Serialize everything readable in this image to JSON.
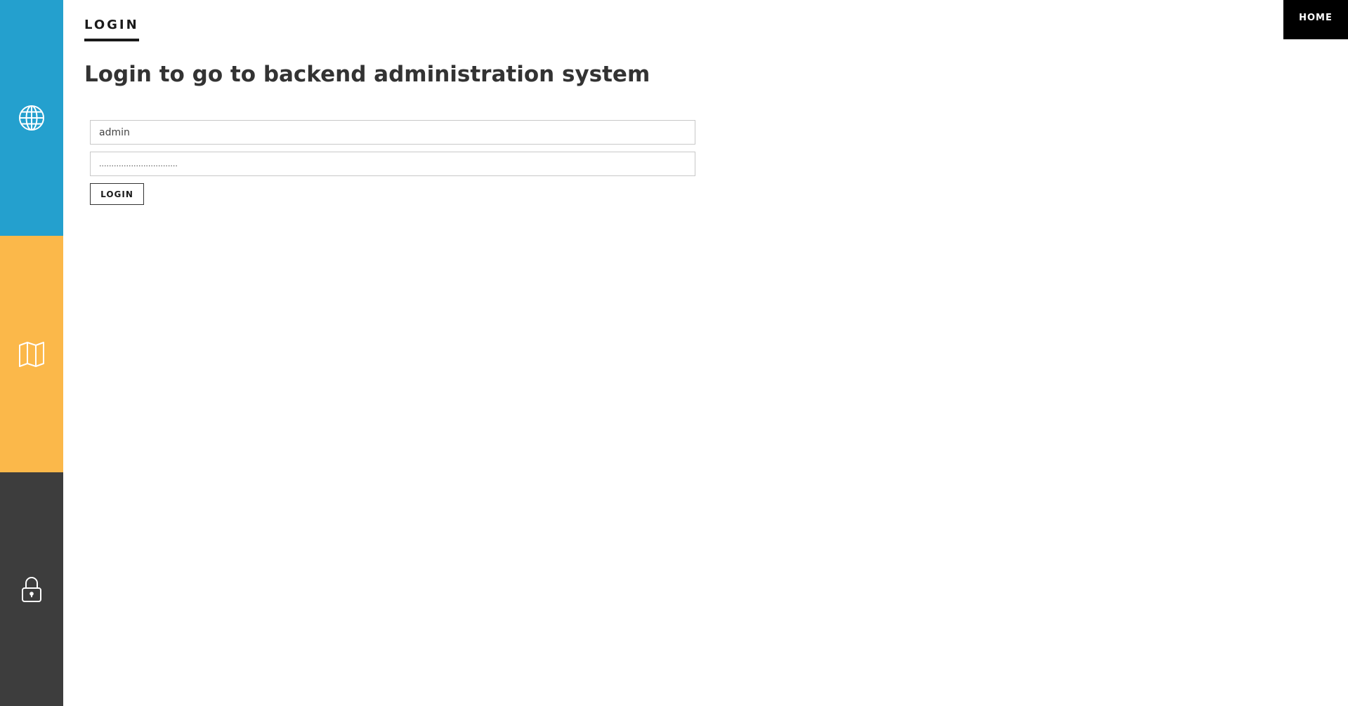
{
  "colors": {
    "sidebar_blue": "#24a0ce",
    "sidebar_orange": "#fbb84a",
    "sidebar_dark": "#3d3d3d",
    "home_bg": "#000000"
  },
  "sidebar": {
    "items": [
      {
        "icon": "globe-icon"
      },
      {
        "icon": "map-icon"
      },
      {
        "icon": "lock-icon"
      }
    ]
  },
  "header": {
    "home_label": "HOME"
  },
  "main": {
    "tab_label": "LOGIN",
    "title": "Login to go to backend administration system"
  },
  "form": {
    "username_value": "admin",
    "password_value": "................................",
    "login_label": "LOGIN"
  }
}
